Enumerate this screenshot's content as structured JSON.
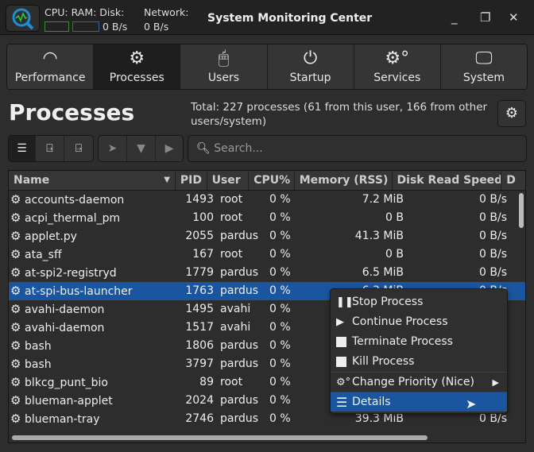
{
  "window": {
    "title": "System Monitoring Center",
    "minimize": "_",
    "maximize": "❐",
    "close": "✕"
  },
  "monitor": {
    "labels": "CPU: RAM: Disk:",
    "disk_speed": "0 B/s",
    "network_label": "Network:",
    "network_speed": "0 B/s",
    "cpu_color": "#3c8a2e",
    "ram_color": "#3a5fa8"
  },
  "tabs": [
    {
      "label": "Performance",
      "icon": "gauge-icon"
    },
    {
      "label": "Processes",
      "icon": "gear-icon"
    },
    {
      "label": "Users",
      "icon": "mouse-icon"
    },
    {
      "label": "Startup",
      "icon": "power-icon"
    },
    {
      "label": "Services",
      "icon": "gears-icon"
    },
    {
      "label": "System",
      "icon": "monitor-icon"
    }
  ],
  "page": {
    "title": "Processes",
    "total": "Total: 227 processes (61 from this user, 166 from other users/system)"
  },
  "search": {
    "placeholder": "Search..."
  },
  "table": {
    "columns": [
      "Name",
      "PID",
      "User",
      "CPU%",
      "Memory (RSS)",
      "Disk Read Speed",
      "D"
    ],
    "rows": [
      [
        "accounts-daemon",
        "1493",
        "root",
        "0 %",
        "7.2 MiB",
        "0 B/s"
      ],
      [
        "acpi_thermal_pm",
        "100",
        "root",
        "0 %",
        "0 B",
        "0 B/s"
      ],
      [
        "applet.py",
        "2055",
        "pardus",
        "0 %",
        "41.3 MiB",
        "0 B/s"
      ],
      [
        "ata_sff",
        "167",
        "root",
        "0 %",
        "0 B",
        "0 B/s"
      ],
      [
        "at-spi2-registryd",
        "1779",
        "pardus",
        "0 %",
        "6.5 MiB",
        "0 B/s"
      ],
      [
        "at-spi-bus-launcher",
        "1763",
        "pardus",
        "0 %",
        "6.3 MiB",
        "0 B/s"
      ],
      [
        "avahi-daemon",
        "1495",
        "avahi",
        "0 %",
        "",
        ""
      ],
      [
        "avahi-daemon",
        "1517",
        "avahi",
        "0 %",
        "",
        ""
      ],
      [
        "bash",
        "1806",
        "pardus",
        "0 %",
        "",
        ""
      ],
      [
        "bash",
        "3797",
        "pardus",
        "0 %",
        "",
        ""
      ],
      [
        "blkcg_punt_bio",
        "89",
        "root",
        "0 %",
        "",
        ""
      ],
      [
        "blueman-applet",
        "2024",
        "pardus",
        "0 %",
        "",
        ""
      ],
      [
        "blueman-tray",
        "2746",
        "pardus",
        "0 %",
        "39.3 MiB",
        "0 B/s"
      ]
    ],
    "selected_index": 5
  },
  "context_menu": {
    "items": [
      "Stop Process",
      "Continue Process",
      "Terminate Process",
      "Kill Process",
      "Change Priority (Nice)",
      "Details"
    ]
  },
  "accent": "#1a56a0"
}
